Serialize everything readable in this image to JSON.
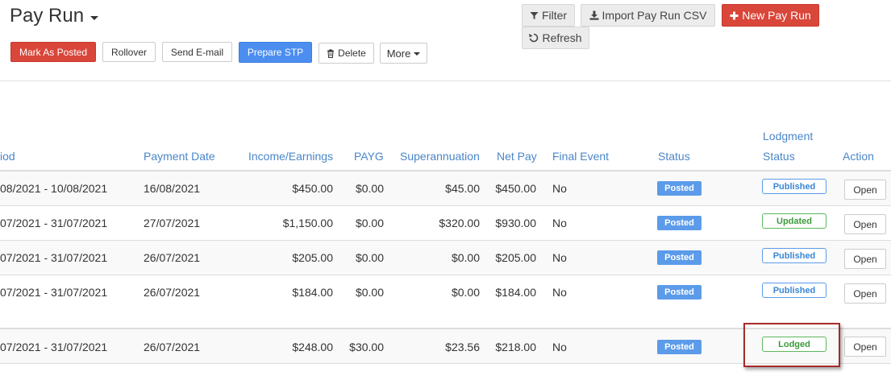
{
  "header": {
    "title": "Pay Run",
    "buttons": {
      "mark_posted": "Mark As Posted",
      "rollover": "Rollover",
      "send_email": "Send E-mail",
      "prepare_stp": "Prepare STP",
      "delete": "Delete",
      "more": "More"
    },
    "toolbar": {
      "filter": "Filter",
      "import": "Import Pay Run CSV",
      "new_pay_run": "New Pay Run",
      "refresh": "Refresh"
    }
  },
  "colors": {
    "accent_red": "#d9463a",
    "accent_blue": "#4b8ef0",
    "header_text": "#4a86c8",
    "badge_blue": "#5b9bea",
    "badge_green": "#5cb85c"
  },
  "table": {
    "columns": {
      "period": "iod",
      "payment_date": "Payment Date",
      "income": "Income/Earnings",
      "payg": "PAYG",
      "super": "Superannuation",
      "net_pay": "Net Pay",
      "final_event": "Final Event",
      "status": "Status",
      "lodgment_line1": "Lodgment",
      "lodgment_line2": "Status",
      "action": "Action"
    },
    "rows": [
      {
        "period": "08/2021 - 10/08/2021",
        "payment_date": "16/08/2021",
        "income": "$450.00",
        "payg": "$0.00",
        "super": "$45.00",
        "net_pay": "$450.00",
        "final_event": "No",
        "status": "Posted",
        "lodgment": "Published",
        "action": "Open"
      },
      {
        "period": "07/2021 - 31/07/2021",
        "payment_date": "27/07/2021",
        "income": "$1,150.00",
        "payg": "$0.00",
        "super": "$320.00",
        "net_pay": "$930.00",
        "final_event": "No",
        "status": "Posted",
        "lodgment": "Updated",
        "action": "Open"
      },
      {
        "period": "07/2021 - 31/07/2021",
        "payment_date": "26/07/2021",
        "income": "$205.00",
        "payg": "$0.00",
        "super": "$0.00",
        "net_pay": "$205.00",
        "final_event": "No",
        "status": "Posted",
        "lodgment": "Published",
        "action": "Open"
      },
      {
        "period": "07/2021 - 31/07/2021",
        "payment_date": "26/07/2021",
        "income": "$184.00",
        "payg": "$0.00",
        "super": "$0.00",
        "net_pay": "$184.00",
        "final_event": "No",
        "status": "Posted",
        "lodgment": "Published",
        "action": "Open"
      },
      {
        "period": "07/2021 - 31/07/2021",
        "payment_date": "26/07/2021",
        "income": "$248.00",
        "payg": "$30.00",
        "super": "$23.56",
        "net_pay": "$218.00",
        "final_event": "No",
        "status": "Posted",
        "lodgment": "Lodged",
        "action": "Open"
      }
    ]
  }
}
